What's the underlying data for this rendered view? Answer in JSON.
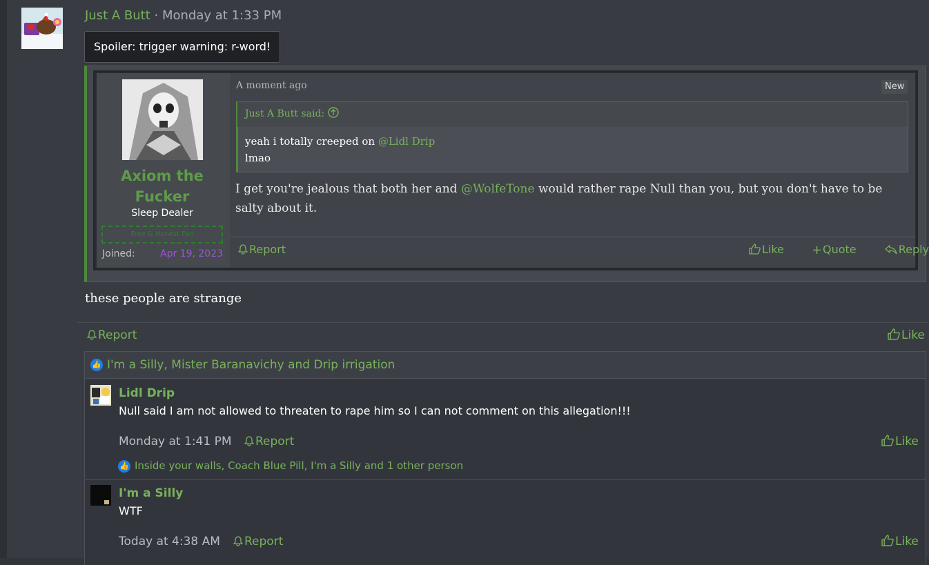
{
  "post": {
    "author": "Just A Butt",
    "time_prefix": "·",
    "time": "Monday at 1:33 PM",
    "spoiler_label": "Spoiler: trigger warning: r-word!",
    "body": "these people are strange",
    "report_label": "Report",
    "like_label": "Like"
  },
  "quoted_post": {
    "user_name_line1": "Axiom the",
    "user_name_line2": "Fucker",
    "user_title": "Sleep Dealer",
    "banner": "Free & Honest Fan",
    "joined_label": "Joined:",
    "joined_date": "Apr 19, 2023",
    "time": "A moment ago",
    "new_badge": "New",
    "inner_quote": {
      "said": "Just A Butt said:",
      "line1_prefix": "yeah i totally creeped on",
      "line1_mention": "@Lidl Drip",
      "line2": "lmao"
    },
    "message_part1": "I get you're jealous that both her and",
    "message_mention": "@WolfeTone",
    "message_part2": "would rather rape Null than you, but you don't have to be salty about it.",
    "report_label": "Report",
    "like_label": "Like",
    "quote_label": "Quote",
    "reply_label": "Reply"
  },
  "reactions": {
    "text": "I'm a Silly, Mister Baranavichy and Drip irrigation"
  },
  "comments": [
    {
      "name": "Lidl Drip",
      "text": "Null said I am not allowed to threaten to rape him so I can not comment on this allegation!!!",
      "time": "Monday at 1:41 PM",
      "report_label": "Report",
      "like_label": "Like",
      "reactions": "Inside your walls, Coach Blue Pill, I'm a Silly and 1 other person"
    },
    {
      "name": "I'm a Silly",
      "text": "WTF",
      "time": "Today at 4:38 AM",
      "report_label": "Report",
      "like_label": "Like"
    }
  ],
  "colors": {
    "link_green": "#79b15b",
    "background": "#383c42",
    "reaction_blue": "#1e7ee6",
    "joined_purple": "#9a56d6"
  },
  "icons": [
    "bell-icon",
    "thumbs-up-icon",
    "plus-icon",
    "reply-arrow-icon",
    "arrow-up-circle-icon",
    "like-reaction-icon"
  ]
}
